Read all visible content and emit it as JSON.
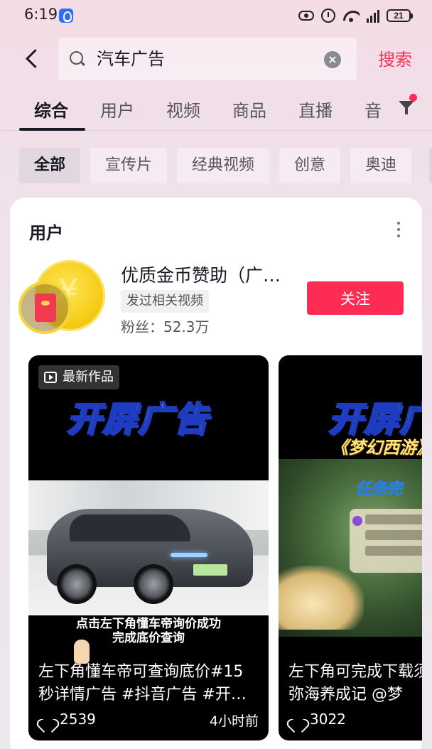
{
  "status_bar": {
    "time": "6:19",
    "network": "5G",
    "battery": "21"
  },
  "search": {
    "value": "汽车广告",
    "search_label": "搜索"
  },
  "tabs": [
    {
      "label": "综合",
      "active": true
    },
    {
      "label": "用户"
    },
    {
      "label": "视频"
    },
    {
      "label": "商品"
    },
    {
      "label": "直播"
    },
    {
      "label": "音"
    }
  ],
  "chips": [
    {
      "label": "全部",
      "active": true
    },
    {
      "label": "宣传片"
    },
    {
      "label": "经典视频"
    },
    {
      "label": "创意"
    },
    {
      "label": "奥迪"
    }
  ],
  "user_section": {
    "title": "用户",
    "user": {
      "name": "优质金币赞助（广…",
      "tag": "发过相关视频",
      "fans": "粉丝：52.3万",
      "follow_label": "关注"
    }
  },
  "videos": [
    {
      "badge": "最新作品",
      "headline": "开屏广告",
      "overlay_line1": "点击左下角懂车帝询价成功",
      "overlay_line2": "完成底价查询",
      "title": "左下角懂车帝可查询底价#15秒详情广告 #抖音广告 #开…",
      "likes": "2539",
      "time": "4小时前"
    },
    {
      "headline": "开屏广",
      "subtitle": "《梦幻西游》",
      "mission": "任务完",
      "title": "左下角可完成下载须弥海养成记 @梦",
      "likes": "3022"
    }
  ],
  "colors": {
    "accent": "#fe2c55",
    "text": "#161823",
    "secondary": "#55565d"
  }
}
